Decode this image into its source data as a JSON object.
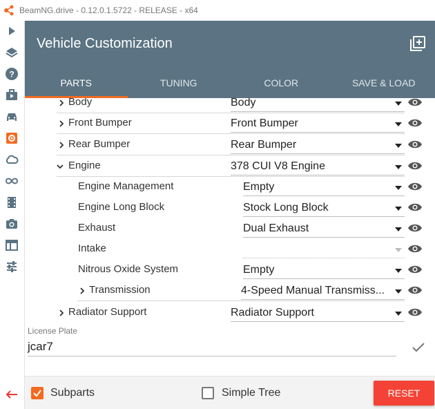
{
  "window": {
    "title": "BeamNG.drive - 0.12.0.1.5722 - RELEASE - x64"
  },
  "sidebar": {
    "icons": [
      "play-icon",
      "layers-icon",
      "help-icon",
      "career-icon",
      "vehicle-icon",
      "vehicle-config-icon",
      "cloud-icon",
      "infinity-icon",
      "film-icon",
      "camera-icon",
      "layout-icon",
      "sliders-icon"
    ],
    "active_color": "#f26b21",
    "back_icon": "back-arrow-icon"
  },
  "header": {
    "title": "Vehicle Customization",
    "tabs": [
      {
        "label": "PARTS",
        "active": true
      },
      {
        "label": "TUNING",
        "active": false
      },
      {
        "label": "COLOR",
        "active": false
      },
      {
        "label": "SAVE & LOAD",
        "active": false
      }
    ],
    "background": "#5b7382",
    "accent": "#f26b21"
  },
  "parts": [
    {
      "label": "Body",
      "value": "Body",
      "expanded": false,
      "level": 0
    },
    {
      "label": "Front Bumper",
      "value": "Front Bumper",
      "expanded": false,
      "level": 0
    },
    {
      "label": "Rear Bumper",
      "value": "Rear Bumper",
      "expanded": false,
      "level": 0
    },
    {
      "label": "Engine",
      "value": "378 CUI V8 Engine",
      "expanded": true,
      "level": 0
    },
    {
      "label": "Engine Management",
      "value": "Empty",
      "level": 1
    },
    {
      "label": "Engine Long Block",
      "value": "Stock Long Block",
      "level": 1
    },
    {
      "label": "Exhaust",
      "value": "Dual Exhaust",
      "level": 1
    },
    {
      "label": "Intake",
      "value": "",
      "level": 1,
      "disabled": true
    },
    {
      "label": "Nitrous Oxide System",
      "value": "Empty",
      "level": 1
    },
    {
      "label": "Transmission",
      "value": "4-Speed Manual Transmiss...",
      "expanded": false,
      "level": 1
    },
    {
      "label": "Radiator Support",
      "value": "Radiator Support",
      "expanded": false,
      "level": 0
    }
  ],
  "license_plate": {
    "label": "License Plate",
    "value": "jcar7"
  },
  "footer": {
    "subparts_label": "Subparts",
    "subparts_checked": true,
    "simple_tree_label": "Simple Tree",
    "simple_tree_checked": false,
    "reset_label": "RESET",
    "reset_color": "#f44336"
  }
}
